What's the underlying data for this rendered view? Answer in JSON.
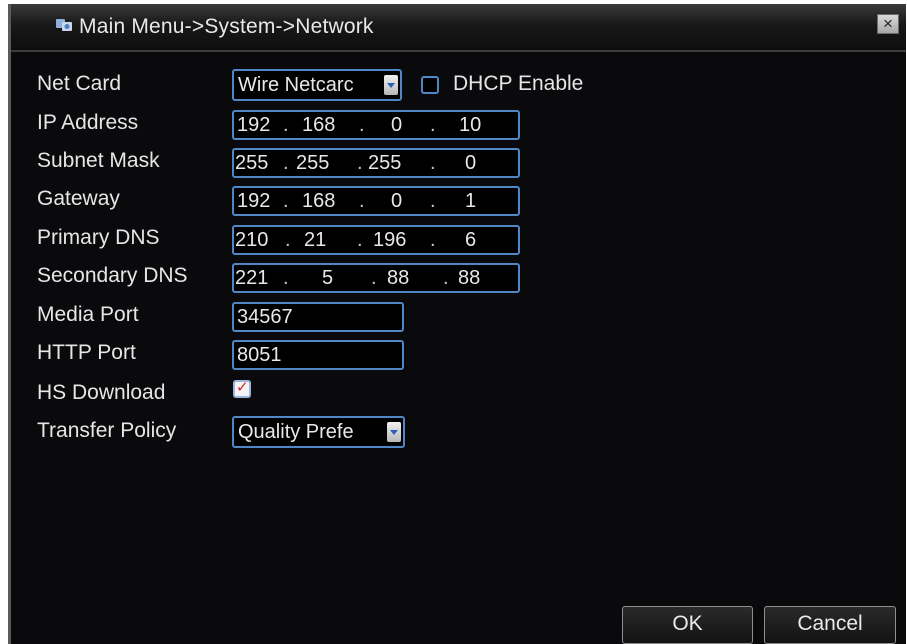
{
  "window": {
    "title": "Main Menu->System->Network",
    "title_icon": "settings-gear-icon",
    "close_label": "×"
  },
  "form": {
    "net_card": {
      "label": "Net Card",
      "value": "Wire Netcarc",
      "dhcp_label": "DHCP Enable",
      "dhcp_checked": false
    },
    "ip_address": {
      "label": "IP Address",
      "octets": [
        "192",
        "168",
        "0",
        "10"
      ]
    },
    "subnet_mask": {
      "label": "Subnet Mask",
      "octets": [
        "255",
        "255",
        "255",
        "0"
      ]
    },
    "gateway": {
      "label": "Gateway",
      "octets": [
        "192",
        "168",
        "0",
        "1"
      ]
    },
    "primary_dns": {
      "label": "Primary DNS",
      "octets": [
        "210",
        "21",
        "196",
        "6"
      ]
    },
    "secondary_dns": {
      "label": "Secondary DNS",
      "octets": [
        "221",
        "5",
        "88",
        "88"
      ]
    },
    "media_port": {
      "label": "Media Port",
      "value": "34567"
    },
    "http_port": {
      "label": "HTTP Port",
      "value": "8051"
    },
    "hs_download": {
      "label": "HS Download",
      "checked": true
    },
    "transfer_policy": {
      "label": "Transfer Policy",
      "value": "Quality Prefe"
    }
  },
  "buttons": {
    "ok": "OK",
    "cancel": "Cancel"
  },
  "colors": {
    "field_border": "#4f86c6",
    "background": "#0a0a0c",
    "text": "#e6e6e6",
    "check": "#d72424"
  }
}
